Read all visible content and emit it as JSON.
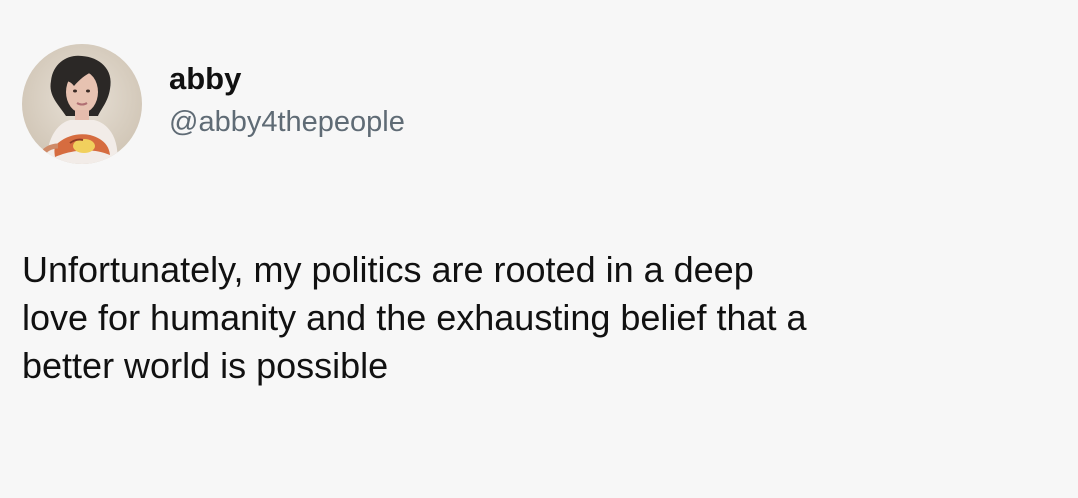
{
  "tweet": {
    "author": {
      "display_name": "abby",
      "handle": "@abby4thepeople",
      "avatar_icon": "profile-photo"
    },
    "body_lines": [
      "Unfortunately, my politics are rooted in a deep",
      "love for humanity and the exhausting belief that a",
      "better world is possible"
    ]
  },
  "colors": {
    "background": "#f7f7f7",
    "text": "#111111",
    "handle": "#5f6b75"
  }
}
